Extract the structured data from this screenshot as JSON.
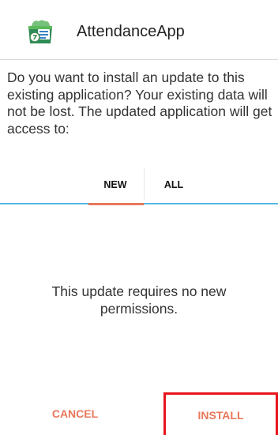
{
  "header": {
    "app_name": "AttendanceApp",
    "icon": "attendance-app-icon"
  },
  "message": "Do you want to install an update to this existing application? Your existing data will not be lost. The updated application will get access to:",
  "tabs": [
    {
      "label": "NEW",
      "active": true
    },
    {
      "label": "ALL",
      "active": false
    }
  ],
  "permissions": {
    "text": "This update requires no new permissions."
  },
  "buttons": {
    "cancel": "CANCEL",
    "install": "INSTALL"
  },
  "colors": {
    "accent": "#e8775a",
    "tab_underline": "#57b6e4",
    "highlight_border": "#e8141c"
  }
}
